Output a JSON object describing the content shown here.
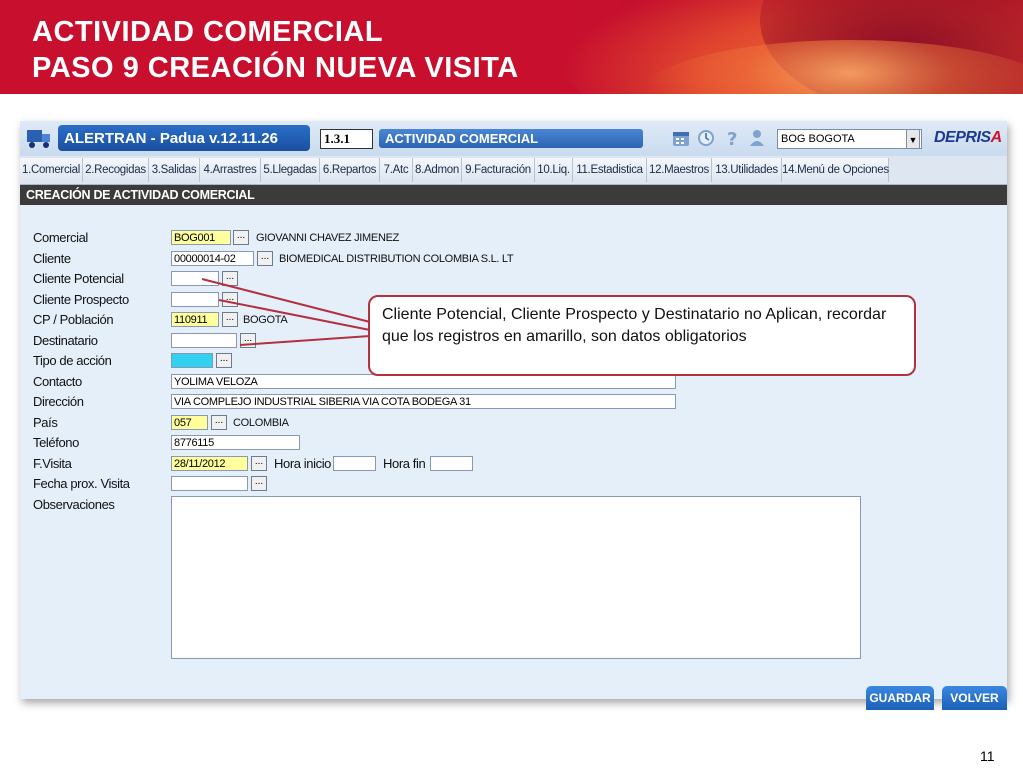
{
  "slide": {
    "title_line1": "ACTIVIDAD COMERCIAL",
    "title_line2": "PASO 9 CREACIÓN NUEVA VISITA",
    "page_number": "11"
  },
  "app": {
    "title": "ALERTRAN - Padua  v.12.11.26",
    "code": "1.3.1",
    "module": "ACTIVIDAD COMERCIAL",
    "office": "BOG BOGOTA",
    "brand_main": "DEPRIS",
    "brand_accent": "A",
    "toolbar_icons": [
      "calendar-icon",
      "clock-icon",
      "help-icon",
      "user-icon"
    ],
    "menu": [
      "1.Comercial",
      "2.Recogidas",
      "3.Salidas",
      "4.Arrastres",
      "5.Llegadas",
      "6.Repartos",
      "7.Atc",
      "8.Admon",
      "9.Facturación",
      "10.Liq.",
      "11.Estadistica",
      "12.Maestros",
      "13.Utilidades",
      "14.Menú de Opciones"
    ],
    "section_title": "CREACIÓN DE ACTIVIDAD COMERCIAL"
  },
  "form": {
    "comercial": {
      "label": "Comercial",
      "value": "BOG001",
      "description": "GIOVANNI CHAVEZ JIMENEZ"
    },
    "cliente": {
      "label": "Cliente",
      "value": "00000014-02",
      "description": "BIOMEDICAL DISTRIBUTION COLOMBIA S.L. LT"
    },
    "cliente_potencial": {
      "label": "Cliente Potencial",
      "value": ""
    },
    "cliente_prospecto": {
      "label": "Cliente Prospecto",
      "value": ""
    },
    "cp_poblacion": {
      "label": "CP / Población",
      "value": "110911",
      "description": "BOGOTA"
    },
    "destinatario": {
      "label": "Destinatario",
      "value": ""
    },
    "tipo_accion": {
      "label": "Tipo de acción",
      "value": ""
    },
    "contacto": {
      "label": "Contacto",
      "value": "YOLIMA VELOZA"
    },
    "direccion": {
      "label": "Dirección",
      "value": "VIA COMPLEJO INDUSTRIAL SIBERIA VIA COTA BODEGA 31"
    },
    "pais": {
      "label": "País",
      "value": "057",
      "description": "COLOMBIA"
    },
    "telefono": {
      "label": "Teléfono",
      "value": "8776115"
    },
    "f_visita": {
      "label": "F.Visita",
      "value": "28/11/2012"
    },
    "hora_inicio": {
      "label": "Hora inicio",
      "value": ""
    },
    "hora_fin": {
      "label": "Hora fin",
      "value": ""
    },
    "fecha_prox_visita": {
      "label": "Fecha prox. Visita",
      "value": ""
    },
    "observaciones": {
      "label": "Observaciones",
      "value": ""
    },
    "lookup_label": "..."
  },
  "buttons": {
    "guardar": "GUARDAR",
    "volver": "VOLVER"
  },
  "callout": {
    "text": "Cliente Potencial, Cliente Prospecto y Destinatario no Aplican, recordar que los registros en amarillo, son datos obligatorios"
  },
  "colors": {
    "header_red": "#c8102e",
    "required_yellow": "#ffff9e",
    "active_cyan": "#33d0f0",
    "callout_border": "#b3303f",
    "button_blue": "#1b5fb8"
  }
}
